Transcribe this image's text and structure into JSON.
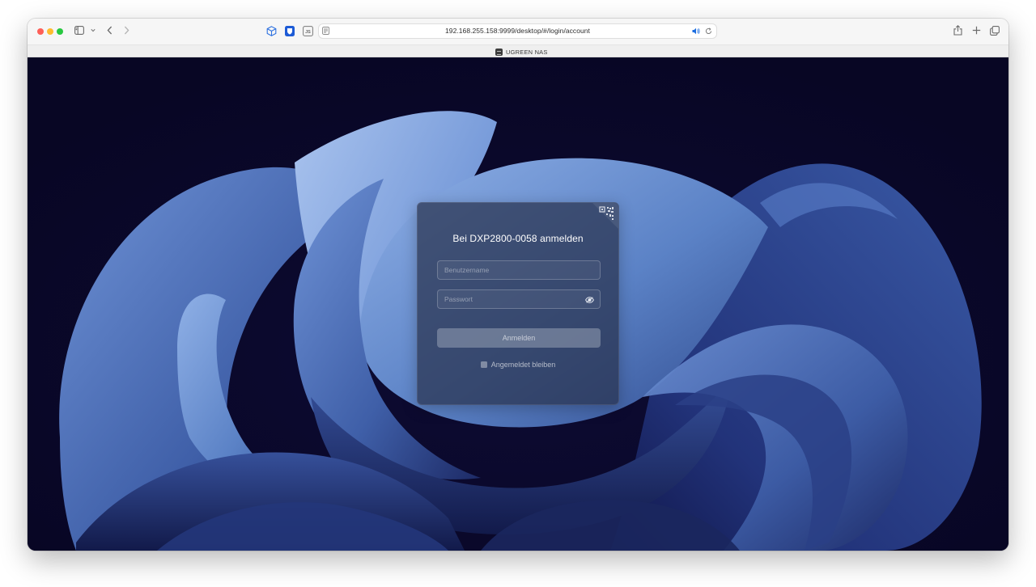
{
  "browser": {
    "url": "192.168.255.158:9999/desktop/#/login/account",
    "icons": {
      "sidebar": "sidebar-icon",
      "sidebar_menu": "chevron-down-icon",
      "back": "chevron-left-icon",
      "forward": "chevron-right-icon",
      "extension_1": "cube-icon",
      "extension_2": "bitwarden-shield-icon",
      "extension_3": "js-icon",
      "reader": "reader-icon",
      "audio": "speaker-icon",
      "reload": "reload-icon",
      "share": "share-icon",
      "new_tab": "plus-icon",
      "tab_overview": "tabs-overview-icon"
    },
    "extension_3_label": "JS"
  },
  "tab": {
    "title": "UGREEN NAS",
    "favicon": "nas-icon"
  },
  "login": {
    "title": "Bei DXP2800-0058 anmelden",
    "username_placeholder": "Benutzername",
    "password_placeholder": "Passwort",
    "submit_label": "Anmelden",
    "remember_label": "Angemeldet bleiben",
    "remember_checked": false,
    "qr_icon": "qr-code-icon",
    "toggle_password_icon": "eye-icon"
  },
  "colors": {
    "background": "#090726",
    "accent_blue": "#5b82c6",
    "card": "#28324e",
    "traffic_red": "#fe5f57",
    "traffic_yellow": "#febc2e",
    "traffic_green": "#28c840",
    "extension_blue": "#1d5bd6"
  }
}
